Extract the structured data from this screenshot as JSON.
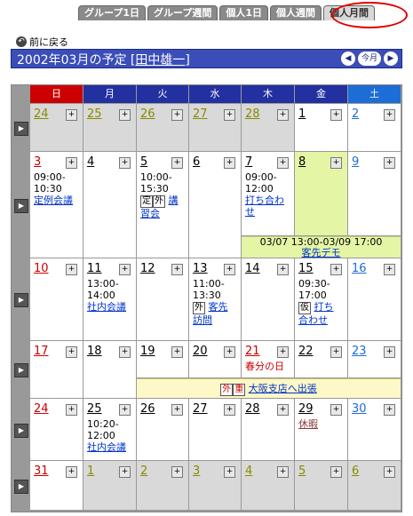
{
  "tabs": [
    {
      "label": "グループ1日",
      "active": false
    },
    {
      "label": "グループ週間",
      "active": false
    },
    {
      "label": "個人1日",
      "active": false
    },
    {
      "label": "個人週間",
      "active": false
    },
    {
      "label": "個人月間",
      "active": true
    }
  ],
  "back_label": "前に戻る",
  "title": {
    "prefix": "2002年03月の予定",
    "user": "田中雄一"
  },
  "nav": {
    "prev": "◀",
    "today": "今月",
    "next": "▶"
  },
  "weekdays": [
    "日",
    "月",
    "火",
    "水",
    "木",
    "金",
    "土"
  ],
  "weeks": [
    {
      "days": [
        {
          "n": "24",
          "type": "out",
          "c": "gray"
        },
        {
          "n": "25",
          "type": "out",
          "c": "gray"
        },
        {
          "n": "26",
          "type": "out",
          "c": "gray"
        },
        {
          "n": "27",
          "type": "out",
          "c": "gray"
        },
        {
          "n": "28",
          "type": "out",
          "c": "gray"
        },
        {
          "n": "1",
          "type": "in",
          "c": "blk"
        },
        {
          "n": "2",
          "type": "in",
          "c": "blue"
        }
      ]
    },
    {
      "days": [
        {
          "n": "3",
          "type": "in",
          "c": "red",
          "ev": {
            "time": "09:00-\n10:30",
            "link": "定例会議"
          }
        },
        {
          "n": "4",
          "type": "in",
          "c": "blk"
        },
        {
          "n": "5",
          "type": "in",
          "c": "blk",
          "ev": {
            "time": "10:00-\n15:30",
            "tags": [
              "定",
              "外"
            ],
            "link": "講\n習会"
          }
        },
        {
          "n": "6",
          "type": "in",
          "c": "blk"
        },
        {
          "n": "7",
          "type": "in",
          "c": "blk",
          "ev": {
            "time": "09:00-\n12:00",
            "link": "打ち合わ\nせ"
          }
        },
        {
          "n": "8",
          "type": "today",
          "c": "blk"
        },
        {
          "n": "9",
          "type": "in",
          "c": "blue"
        }
      ]
    },
    {
      "days": [
        {
          "n": "10",
          "type": "in",
          "c": "red"
        },
        {
          "n": "11",
          "type": "in",
          "c": "blk",
          "ev": {
            "time": "13:00-\n14:00",
            "link": "社内会議"
          }
        },
        {
          "n": "12",
          "type": "in",
          "c": "blk"
        },
        {
          "n": "13",
          "type": "in",
          "c": "blk",
          "ev": {
            "time": "11:00-\n13:30",
            "tags": [
              "外"
            ],
            "link": "客先\n訪問"
          }
        },
        {
          "n": "14",
          "type": "in",
          "c": "blk"
        },
        {
          "n": "15",
          "type": "in",
          "c": "blk",
          "ev": {
            "time": "09:30-\n17:00",
            "tags": [
              "仮"
            ],
            "link": "打ち\n合わせ"
          }
        },
        {
          "n": "16",
          "type": "in",
          "c": "blue"
        }
      ]
    },
    {
      "days": [
        {
          "n": "17",
          "type": "in",
          "c": "red"
        },
        {
          "n": "18",
          "type": "in",
          "c": "blk"
        },
        {
          "n": "19",
          "type": "in",
          "c": "blk"
        },
        {
          "n": "20",
          "type": "in",
          "c": "blk"
        },
        {
          "n": "21",
          "type": "in",
          "c": "red",
          "holiday": "春分の日"
        },
        {
          "n": "22",
          "type": "in",
          "c": "blk"
        },
        {
          "n": "23",
          "type": "in",
          "c": "blue"
        }
      ]
    },
    {
      "days": [
        {
          "n": "24",
          "type": "in",
          "c": "red"
        },
        {
          "n": "25",
          "type": "in",
          "c": "blk",
          "ev": {
            "time": "10:20-\n12:00",
            "link": "社内会議"
          }
        },
        {
          "n": "26",
          "type": "in",
          "c": "blk"
        },
        {
          "n": "27",
          "type": "in",
          "c": "blk"
        },
        {
          "n": "28",
          "type": "in",
          "c": "blk"
        },
        {
          "n": "29",
          "type": "in",
          "c": "blk",
          "ev": {
            "link": "休暇",
            "brown": true
          }
        },
        {
          "n": "30",
          "type": "in",
          "c": "blue"
        }
      ]
    },
    {
      "days": [
        {
          "n": "31",
          "type": "in",
          "c": "red"
        },
        {
          "n": "1",
          "type": "out",
          "c": "gray"
        },
        {
          "n": "2",
          "type": "out",
          "c": "gray"
        },
        {
          "n": "3",
          "type": "out",
          "c": "gray"
        },
        {
          "n": "4",
          "type": "out",
          "c": "gray"
        },
        {
          "n": "5",
          "type": "out",
          "c": "gray"
        },
        {
          "n": "6",
          "type": "out",
          "c": "gray"
        }
      ]
    }
  ],
  "multi_events": [
    {
      "text": "03/07 13:00-03/09 17:00",
      "link": "客先デモ"
    },
    {
      "tags": [
        "外",
        "重"
      ],
      "link": "大阪支店へ出張"
    }
  ]
}
